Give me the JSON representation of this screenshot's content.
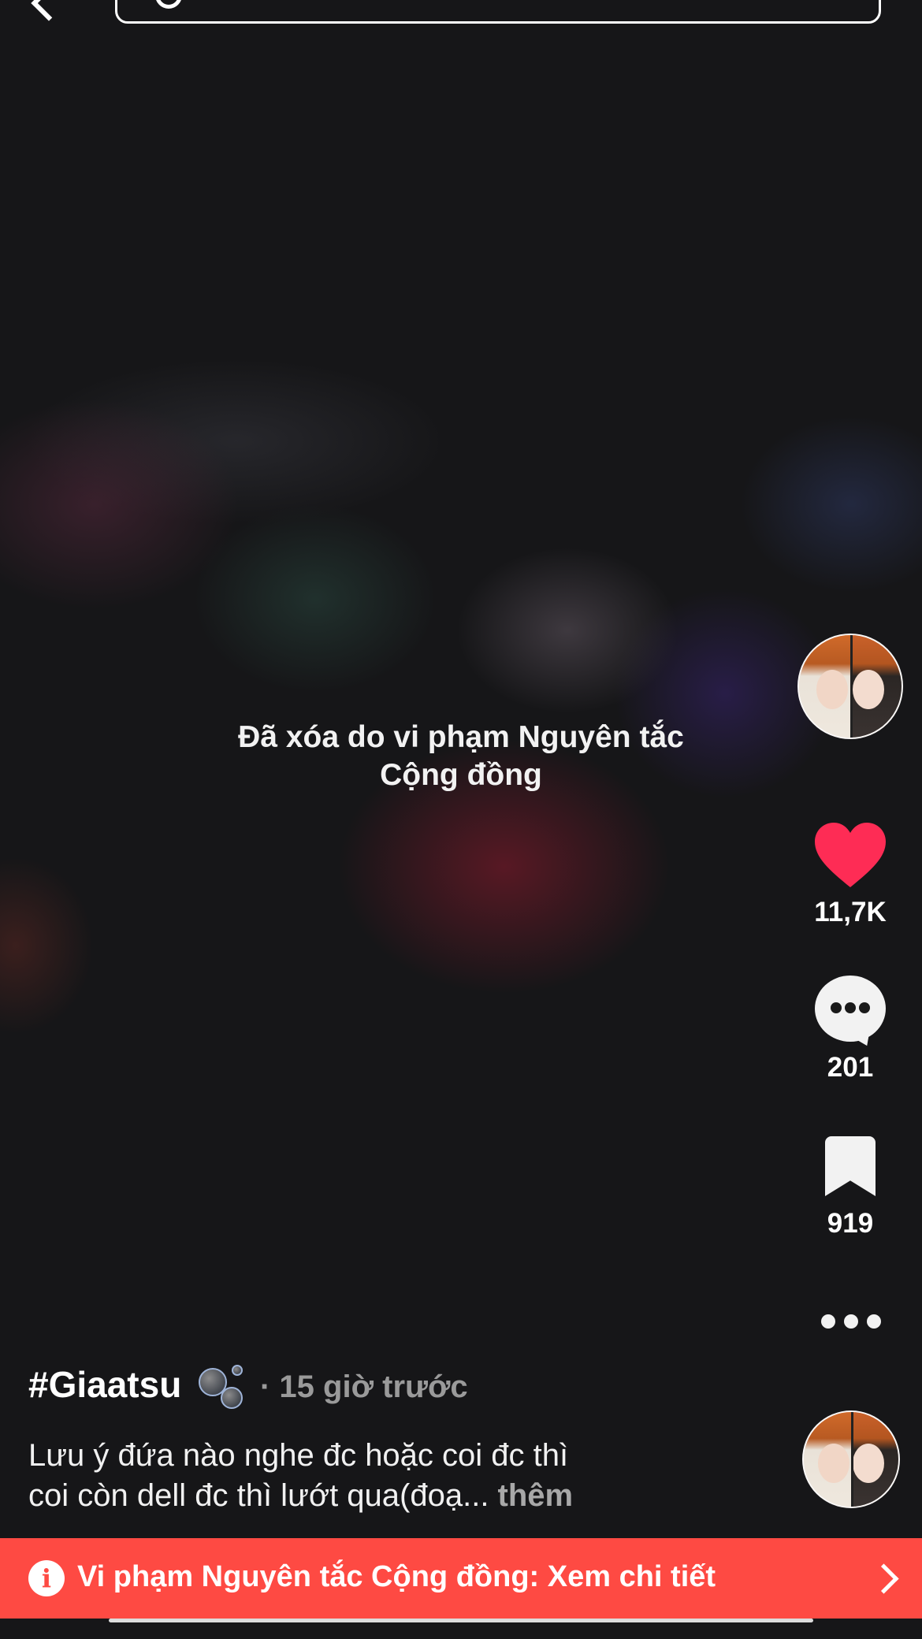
{
  "video": {
    "removed_notice": "Đã xóa do vi phạm Nguyên tắc\nCộng đồng"
  },
  "rail": {
    "like_count": "11,7K",
    "comment_count": "201",
    "bookmark_count": "919"
  },
  "caption": {
    "author": "#Giaatsu",
    "time": "· 15 giờ trước",
    "text": "Lưu ý đứa nào nghe đc hoặc coi đc thì\ncoi còn dell đc thì lướt qua(đoạ... ",
    "more": "thêm"
  },
  "banner": {
    "text": "Vi phạm Nguyên tắc Cộng đồng: Xem chi tiết"
  },
  "colors": {
    "like": "#fe2c55",
    "banner": "#fe4a43",
    "background": "#161618"
  }
}
